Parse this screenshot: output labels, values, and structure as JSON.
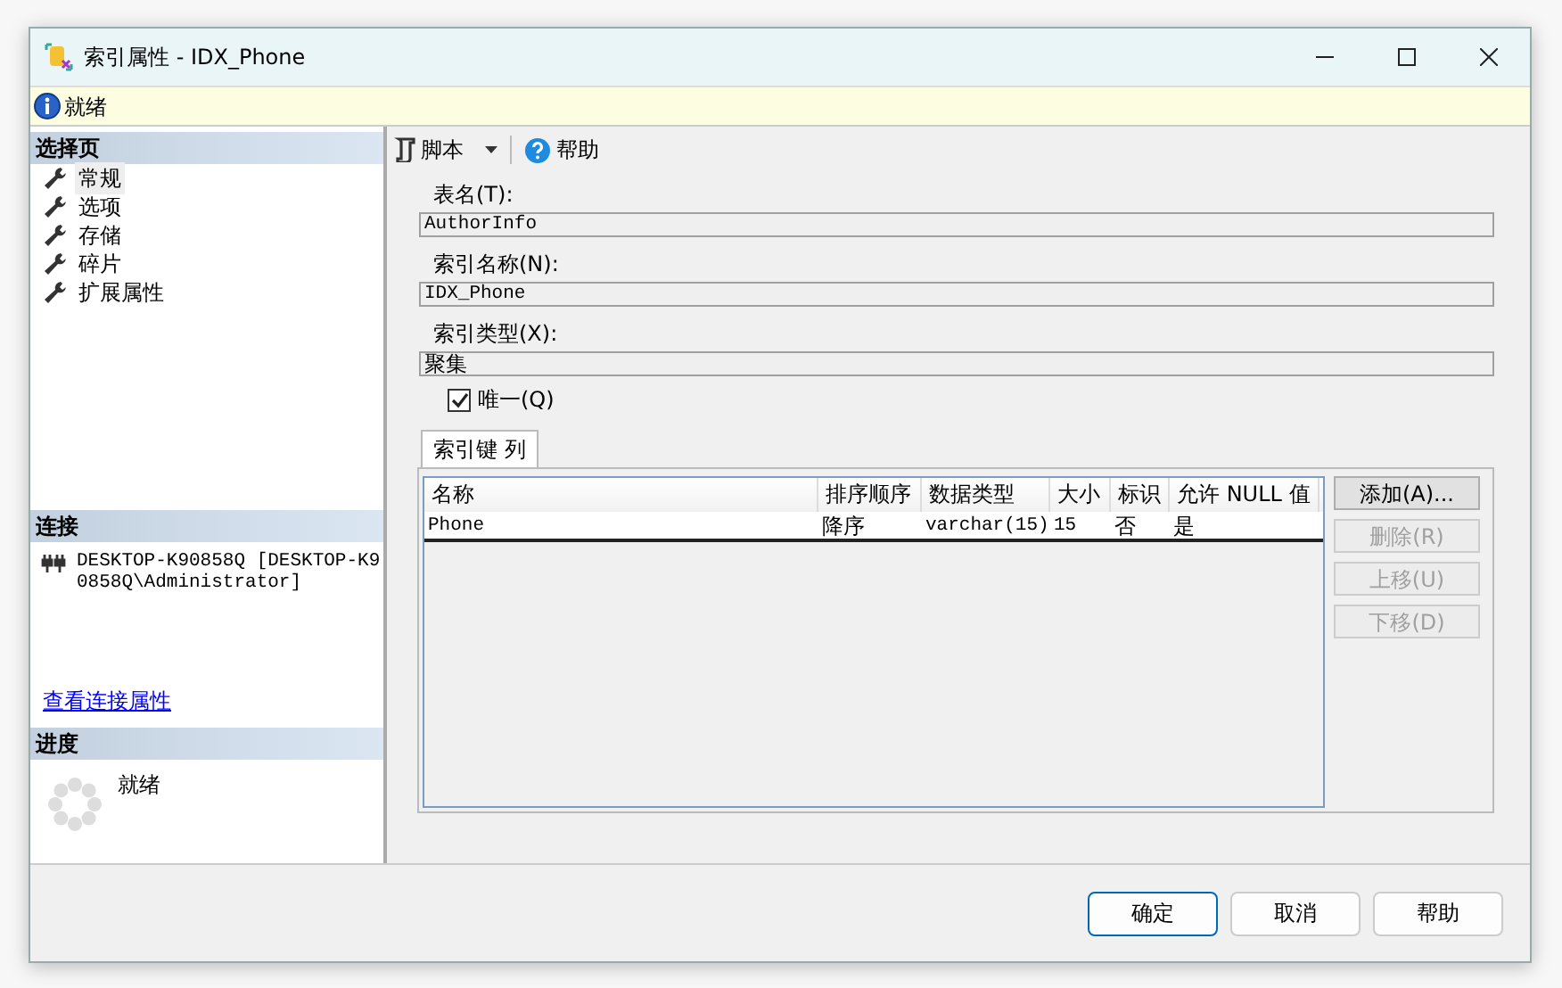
{
  "window": {
    "title": "索引属性 - IDX_Phone"
  },
  "status": {
    "text": "就绪"
  },
  "sidebar": {
    "pages_header": "选择页",
    "pages": [
      {
        "label": "常规",
        "selected": true
      },
      {
        "label": "选项",
        "selected": false
      },
      {
        "label": "存储",
        "selected": false
      },
      {
        "label": "碎片",
        "selected": false
      },
      {
        "label": "扩展属性",
        "selected": false
      }
    ],
    "connection_header": "连接",
    "server": "DESKTOP-K90858Q",
    "user": "[DESKTOP-K90858Q\\Administrator]",
    "view_link": "查看连接属性",
    "progress_header": "进度",
    "progress_status": "就绪"
  },
  "toolbar": [
    {
      "label": "脚本",
      "kind": "script"
    },
    {
      "label": "帮助",
      "kind": "help"
    }
  ],
  "fields": [
    {
      "label": "表名(T):",
      "value": "AuthorInfo"
    },
    {
      "label": "索引名称(N):",
      "value": "IDX_Phone"
    },
    {
      "label": "索引类型(X):",
      "value": "聚集"
    }
  ],
  "unique": {
    "label": "唯一(Q)",
    "checked": true
  },
  "tabs": [
    {
      "label": "索引键 列",
      "selected": true
    }
  ],
  "table": {
    "columns": [
      "名称",
      "排序顺序",
      "数据类型",
      "大小",
      "标识",
      "允许 NULL 值"
    ],
    "rows": [
      [
        "Phone",
        "降序",
        "varchar(15)",
        "15",
        "否",
        "是"
      ]
    ]
  },
  "side_buttons": [
    {
      "label": "添加(A)...",
      "disabled": false
    },
    {
      "label": "删除(R)",
      "disabled": true
    },
    {
      "label": "上移(U)",
      "disabled": true
    },
    {
      "label": "下移(D)",
      "disabled": true
    }
  ],
  "footer_buttons": [
    {
      "label": "确定",
      "default": true
    },
    {
      "label": "取消",
      "default": false
    },
    {
      "label": "帮助",
      "default": false
    }
  ]
}
